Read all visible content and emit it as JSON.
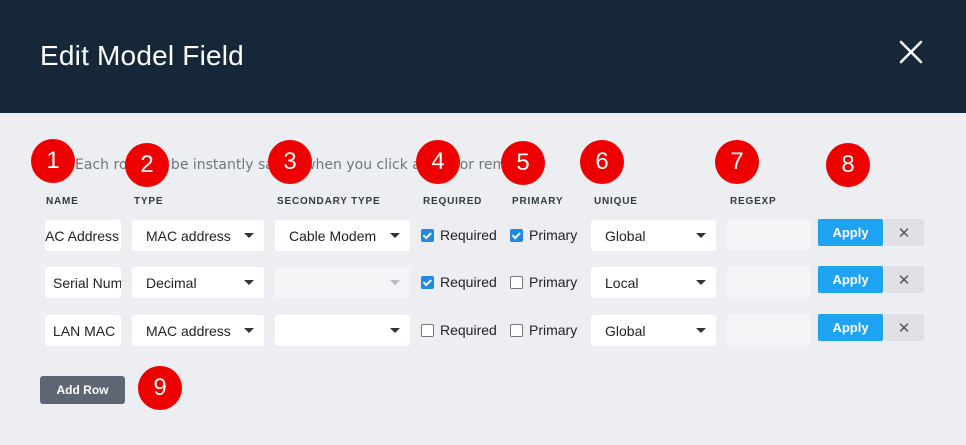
{
  "dialog": {
    "title": "Edit Model Field",
    "close_icon": "close-icon"
  },
  "note": "Each row will be instantly saved when you click apply, or remove.",
  "columns": {
    "name": "NAME",
    "type": "TYPE",
    "secondary_type": "SECONDARY TYPE",
    "required": "REQUIRED",
    "primary": "PRIMARY",
    "unique": "UNIQUE",
    "regexp": "REGEXP"
  },
  "rows": [
    {
      "name": "AC Address",
      "type": "MAC address",
      "secondary_type": "Cable Modem",
      "secondary_disabled": false,
      "required_label": "Required",
      "required": true,
      "primary_label": "Primary",
      "primary": true,
      "unique": "Global",
      "regexp": "",
      "apply_label": "Apply",
      "remove_icon": "close-icon"
    },
    {
      "name": "Serial Num",
      "type": "Decimal",
      "secondary_type": "",
      "secondary_disabled": true,
      "required_label": "Required",
      "required": true,
      "primary_label": "Primary",
      "primary": false,
      "unique": "Local",
      "regexp": "",
      "apply_label": "Apply",
      "remove_icon": "close-icon"
    },
    {
      "name": "LAN MAC",
      "type": "MAC address",
      "secondary_type": "",
      "secondary_disabled": false,
      "required_label": "Required",
      "required": false,
      "primary_label": "Primary",
      "primary": false,
      "unique": "Global",
      "regexp": "",
      "apply_label": "Apply",
      "remove_icon": "close-icon"
    }
  ],
  "add_row_label": "Add Row",
  "markers": [
    "1",
    "2",
    "3",
    "4",
    "5",
    "6",
    "7",
    "8",
    "9"
  ],
  "colors": {
    "header": "#17273a",
    "accent": "#1ea3f3",
    "marker": "#ee0000",
    "background": "#edeef2"
  }
}
